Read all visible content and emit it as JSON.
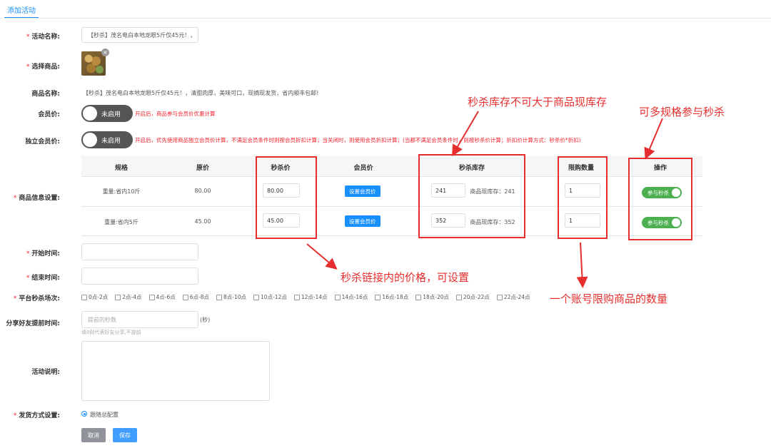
{
  "tab": {
    "label": "添加活动"
  },
  "form": {
    "activity_name": {
      "label": "活动名称:",
      "value": "【秒杀】茂名电白本地龙眼5斤仅45元！，"
    },
    "select_goods": {
      "label": "选择商品:"
    },
    "goods_name": {
      "label": "商品名称:",
      "value": "【秒杀】茂名电白本地龙眼5斤仅45元！，清甜肉厚，美味可口，现摘现发货，省内顺丰包邮!"
    },
    "member_price": {
      "label": "会员价:",
      "toggle": "未启用",
      "note": "开启后，商品参与会员价优惠计算"
    },
    "independent_member_price": {
      "label": "独立会员价:",
      "toggle": "未启用",
      "note": "开启后，优先使用商品独立会员价计算，不满足会员条件时则按会员折扣计算；当关闭时，则使用会员折扣计算；(当都不满足会员条件时，则按秒杀价计算；折扣价计算方式：秒杀价*折扣)"
    },
    "goods_info": {
      "label": "商品信息设置:",
      "columns": [
        "规格",
        "原价",
        "秒杀价",
        "会员价",
        "秒杀库存",
        "限购数量",
        "操作"
      ],
      "rows": [
        {
          "spec": "重量:省内10斤",
          "original": "80.00",
          "seckill_price": "80.00",
          "member_btn": "设置会员价",
          "stock": "241",
          "current_stock": "商品现库存：241",
          "limit": "1",
          "action": "参与秒杀"
        },
        {
          "spec": "重量:省内5斤",
          "original": "45.00",
          "seckill_price": "45.00",
          "member_btn": "设置会员价",
          "stock": "352",
          "current_stock": "商品现库存：352",
          "limit": "1",
          "action": "参与秒杀"
        }
      ]
    },
    "start_time": {
      "label": "开始时间:"
    },
    "end_time": {
      "label": "结束时间:"
    },
    "sessions": {
      "label": "平台秒杀场次:",
      "options": [
        "0点-2点",
        "2点-4点",
        "4点-6点",
        "6点-8点",
        "8点-10点",
        "10点-12点",
        "12点-14点",
        "14点-16点",
        "16点-18点",
        "18点-20点",
        "20点-22点",
        "22点-24点"
      ]
    },
    "share_ahead": {
      "label": "分享好友提前时间:",
      "placeholder": "提前的秒数",
      "unit": "(秒)",
      "hint": "填0则代表好友分享,不提前"
    },
    "description": {
      "label": "活动说明:"
    },
    "shipping": {
      "label": "发货方式设置:",
      "option": "跟随总配置"
    },
    "buttons": {
      "cancel": "取消",
      "save": "保存"
    }
  },
  "annotations": {
    "stock_note": "秒杀库存不可大于商品现库存",
    "multi_spec": "可多规格参与秒杀",
    "price_note": "秒杀链接内的价格，可设置",
    "limit_note": "一个账号限购商品的数量"
  },
  "colors": {
    "accent": "#1890ff",
    "annotation": "#e62e2e",
    "toggle_on": "#4caf50"
  }
}
